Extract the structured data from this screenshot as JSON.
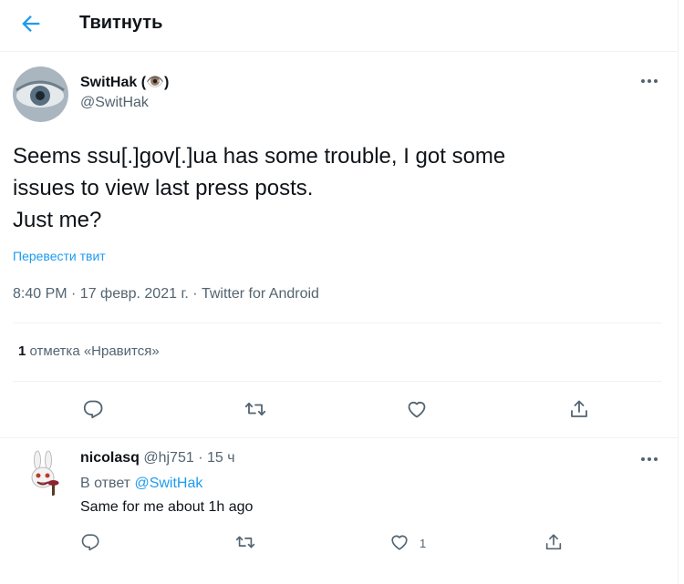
{
  "header": {
    "title": "Твитнуть"
  },
  "tweet": {
    "author_name": "SwitHak (👁️)",
    "author_handle": "@SwitHak",
    "text_lines": [
      "Seems ssu[.]gov[.]ua has some trouble, I got some",
      "issues to view last press posts.",
      "Just me?"
    ],
    "translate_label": "Перевести твит",
    "meta": "8:40 PM · 17 февр. 2021 г. · Twitter for Android",
    "likes_count": "1",
    "likes_label": " отметка «Нравится»"
  },
  "reply": {
    "author_name": "nicolasq",
    "author_handle": "@hj751",
    "time": " · 15 ч",
    "in_reply_prefix": "В ответ ",
    "in_reply_mention": "@SwitHak",
    "text": "Same for me about 1h ago",
    "like_count": "1"
  },
  "colors": {
    "accent": "#1d9bf0",
    "text": "#0f1419",
    "secondary": "#536471",
    "divider": "#eff3f4"
  },
  "icons": [
    "back-arrow-icon",
    "more-icon",
    "reply-icon",
    "retweet-icon",
    "like-icon",
    "share-icon"
  ]
}
